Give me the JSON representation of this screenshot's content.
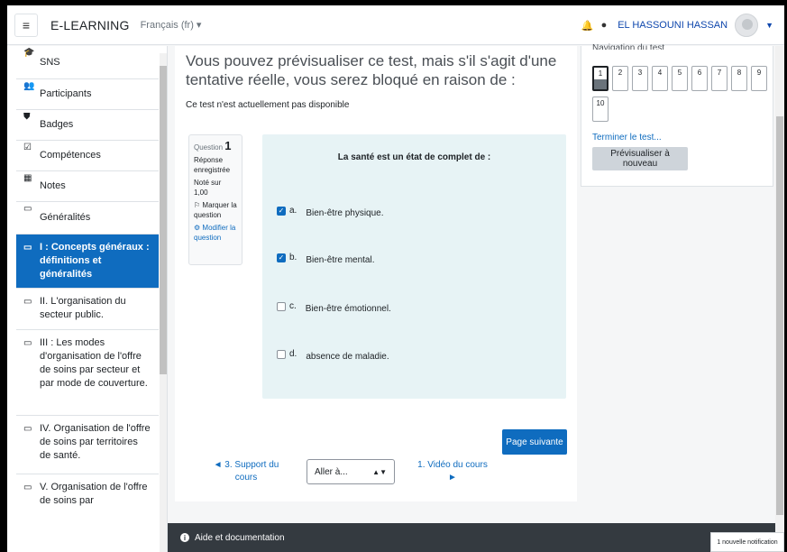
{
  "navbar": {
    "brand": "E-LEARNING",
    "language": "Français (fr) ▾",
    "username": "EL HASSOUNI HASSAN",
    "menu_icon": "hamburger-icon",
    "notification_icon": "bell-icon",
    "message_icon": "chat-icon"
  },
  "sidebar": {
    "items": [
      {
        "label": "SNS",
        "icon": "graduation-cap-icon"
      },
      {
        "label": "Participants",
        "icon": "users-icon"
      },
      {
        "label": "Badges",
        "icon": "shield-icon"
      },
      {
        "label": "Compétences",
        "icon": "checkbox-icon"
      },
      {
        "label": "Notes",
        "icon": "table-icon"
      },
      {
        "label": "Généralités",
        "icon": "folder-icon"
      },
      {
        "label": "I : Concepts généraux : définitions et généralités",
        "icon": "folder-icon"
      },
      {
        "label": "II. L'organisation du secteur public.",
        "icon": "folder-icon"
      },
      {
        "label": "III : Les modes d'organisation de l'offre de soins par secteur et par mode de couverture.",
        "icon": "folder-icon"
      },
      {
        "label": "IV. Organisation de l'offre de soins par territoires de santé.",
        "icon": "folder-icon"
      },
      {
        "label": "V. Organisation de l'offre de soins par",
        "icon": "folder-icon"
      }
    ]
  },
  "main": {
    "heading": "Vous pouvez prévisualiser ce test, mais s'il s'agit d'une tentative réelle, vous serez bloqué en raison de :",
    "notice": "Ce test n'est actuellement pas disponible",
    "question_info": {
      "label": "Question",
      "number": "1",
      "state": "Réponse enregistrée",
      "grade": "Noté sur 1,00",
      "flag": "Marquer la question",
      "edit": "Modifier la question"
    },
    "question": {
      "text": "La santé est un état de complet de :",
      "answers": [
        {
          "letter": "a.",
          "text": "Bien-être physique.",
          "checked": true
        },
        {
          "letter": "b.",
          "text": "Bien-être mental.",
          "checked": true
        },
        {
          "letter": "c.",
          "text": "Bien-être émotionnel.",
          "checked": false
        },
        {
          "letter": "d.",
          "text": "absence de maladie.",
          "checked": false
        }
      ]
    },
    "next_page_button": "Page suivante",
    "prev_activity": "◄ 3. Support du cours",
    "jump_select": "Aller à...",
    "next_activity": "1. Vidéo du cours ►"
  },
  "quiz_nav": {
    "title": "Navigation du test",
    "buttons": [
      "1",
      "2",
      "3",
      "4",
      "5",
      "6",
      "7",
      "8",
      "9",
      "10"
    ],
    "finish_link": "Terminer le test...",
    "preview_button": "Prévisualiser à nouveau"
  },
  "footer": {
    "help": "Aide et documentation",
    "toast": "1 nouvelle notification"
  }
}
